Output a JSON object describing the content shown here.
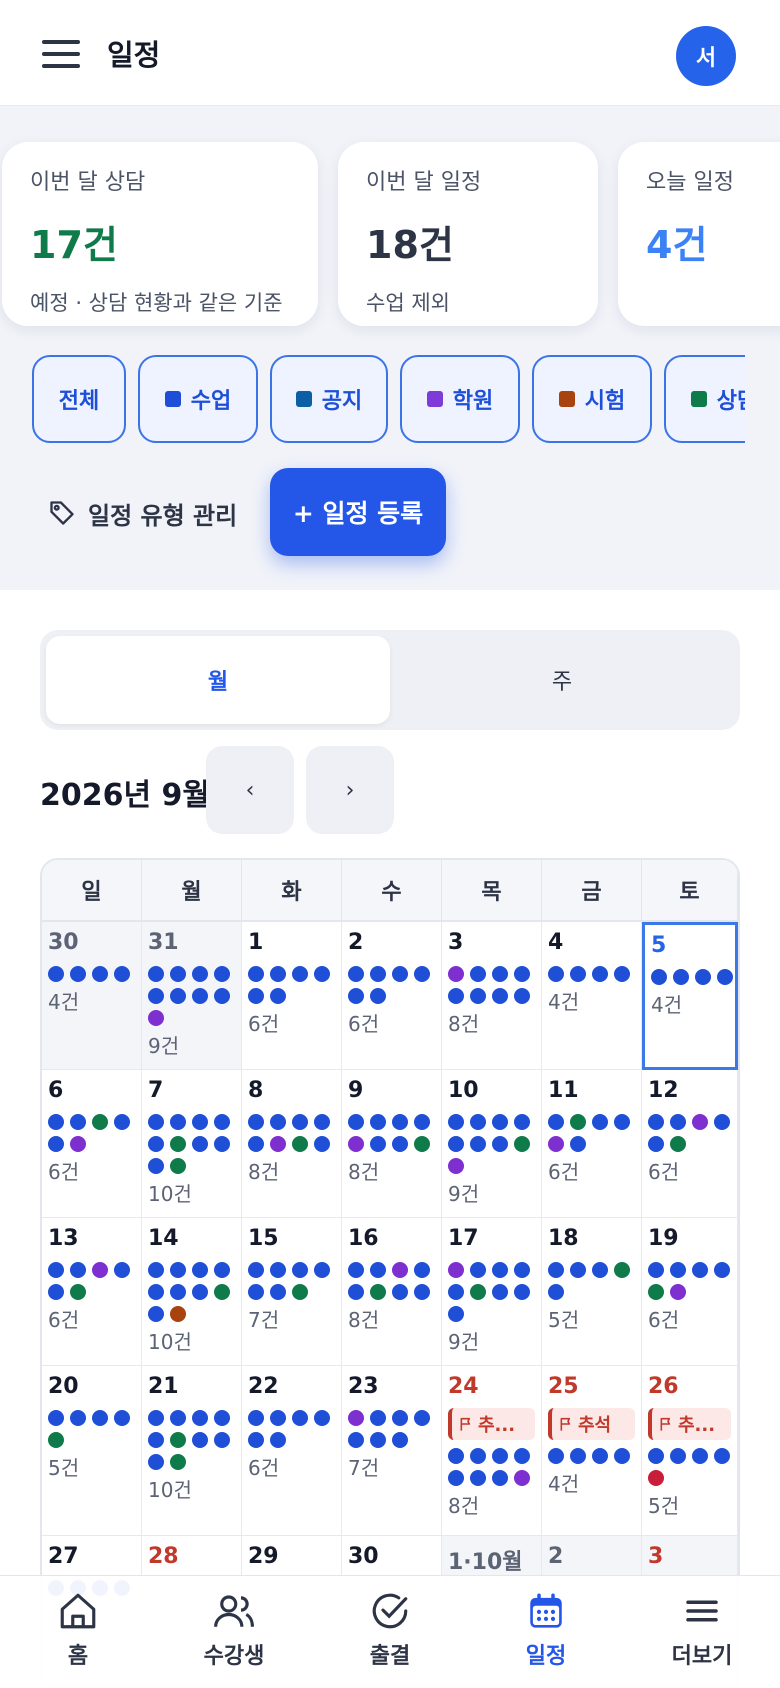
{
  "header": {
    "title": "일정",
    "avatar_initial": "서"
  },
  "stats": [
    {
      "label": "이번 달 상담",
      "value": "17건",
      "sub": "예정 · 상담 현황과 같은 기준",
      "color": "#0f7a4a"
    },
    {
      "label": "이번 달 일정",
      "value": "18건",
      "sub": "수업 제외",
      "color": "#2d3446"
    },
    {
      "label": "오늘 일정",
      "value": "4건",
      "sub": "",
      "color": "#3b82f6"
    }
  ],
  "filters": [
    {
      "label": "전체",
      "color": ""
    },
    {
      "label": "수업",
      "color": "#1d4ed8"
    },
    {
      "label": "공지",
      "color": "#0b5fa5"
    },
    {
      "label": "학원",
      "color": "#7e3bd8"
    },
    {
      "label": "시험",
      "color": "#a8420f"
    },
    {
      "label": "상담",
      "color": "#0f7a4a"
    }
  ],
  "actions": {
    "manage_types": "일정 유형 관리",
    "add_event": "+ 일정 등록",
    "tag_icon": "tag-icon"
  },
  "view_toggle": {
    "month": "월",
    "week": "주",
    "selected": "month"
  },
  "calendar": {
    "month_label": "2026년 9월",
    "prev": "‹",
    "next": "›",
    "weekdays": [
      "일",
      "월",
      "화",
      "수",
      "목",
      "금",
      "토"
    ],
    "dot_colors": {
      "b": "#1f4fd6",
      "p": "#7e2fd0",
      "g": "#0f7a4a",
      "o": "#a8420f",
      "r": "#c81e3a"
    },
    "weeks": [
      [
        {
          "day": "30",
          "other": true,
          "dots": "bbbb",
          "count": "4건"
        },
        {
          "day": "31",
          "other": true,
          "dots": "bbbbbbbbp",
          "count": "9건"
        },
        {
          "day": "1",
          "dots": "bbbbbb",
          "count": "6건"
        },
        {
          "day": "2",
          "dots": "bbbbbb",
          "count": "6건"
        },
        {
          "day": "3",
          "dots": "pbbbbbbb",
          "count": "8건"
        },
        {
          "day": "4",
          "dots": "bbbb",
          "count": "4건"
        },
        {
          "day": "5",
          "today": true,
          "dots": "bbbb",
          "count": "4건"
        }
      ],
      [
        {
          "day": "6",
          "dots": "bbgbbp",
          "count": "6건"
        },
        {
          "day": "7",
          "dots": "bbbbbgbbbg",
          "count": "10건"
        },
        {
          "day": "8",
          "dots": "bbbbbpgb",
          "count": "8건"
        },
        {
          "day": "9",
          "dots": "bbbbpbbg",
          "count": "8건"
        },
        {
          "day": "10",
          "dots": "bbbbbbbgp",
          "count": "9건"
        },
        {
          "day": "11",
          "dots": "bgbbpb",
          "count": "6건"
        },
        {
          "day": "12",
          "dots": "bbpbbg",
          "count": "6건"
        }
      ],
      [
        {
          "day": "13",
          "dots": "bbpbbg",
          "count": "6건"
        },
        {
          "day": "14",
          "dots": "bbbbbbbgbo",
          "count": "10건"
        },
        {
          "day": "15",
          "dots": "bbbbbbg",
          "count": "7건"
        },
        {
          "day": "16",
          "dots": "bbpbbgbb",
          "count": "8건"
        },
        {
          "day": "17",
          "dots": "pbbbbgbbb",
          "count": "9건"
        },
        {
          "day": "18",
          "dots": "bbbgb",
          "count": "5건"
        },
        {
          "day": "19",
          "dots": "bbbbgp",
          "count": "6건"
        }
      ],
      [
        {
          "day": "20",
          "dots": "bbbbg",
          "count": "5건"
        },
        {
          "day": "21",
          "dots": "bbbbbgbbbg",
          "count": "10건"
        },
        {
          "day": "22",
          "dots": "bbbbbb",
          "count": "6건"
        },
        {
          "day": "23",
          "dots": "pbbbbbb",
          "count": "7건"
        },
        {
          "day": "24",
          "red": true,
          "holiday": "추...",
          "dots": "bbbbbbbp",
          "count": "8건"
        },
        {
          "day": "25",
          "red": true,
          "holiday": "추석",
          "dots": "bbbb",
          "count": "4건"
        },
        {
          "day": "26",
          "red": true,
          "holiday": "추...",
          "dots": "bbbbr",
          "count": "5건"
        }
      ],
      [
        {
          "day": "27",
          "dots": "bbbb",
          "count": ""
        },
        {
          "day": "28",
          "red": true,
          "dots": "",
          "count": ""
        },
        {
          "day": "29",
          "dots": "",
          "count": ""
        },
        {
          "day": "30",
          "dots": "",
          "count": ""
        },
        {
          "day": "1·10월",
          "other": true,
          "dots": "",
          "count": ""
        },
        {
          "day": "2",
          "other": true,
          "dots": "",
          "count": ""
        },
        {
          "day": "3",
          "other": true,
          "red": true,
          "dots": "",
          "count": ""
        }
      ]
    ]
  },
  "tabbar": [
    {
      "label": "홈",
      "icon": "home-icon"
    },
    {
      "label": "수강생",
      "icon": "users-icon"
    },
    {
      "label": "출결",
      "icon": "check-circle-icon"
    },
    {
      "label": "일정",
      "icon": "calendar-icon",
      "active": true
    },
    {
      "label": "더보기",
      "icon": "menu-icon"
    }
  ]
}
